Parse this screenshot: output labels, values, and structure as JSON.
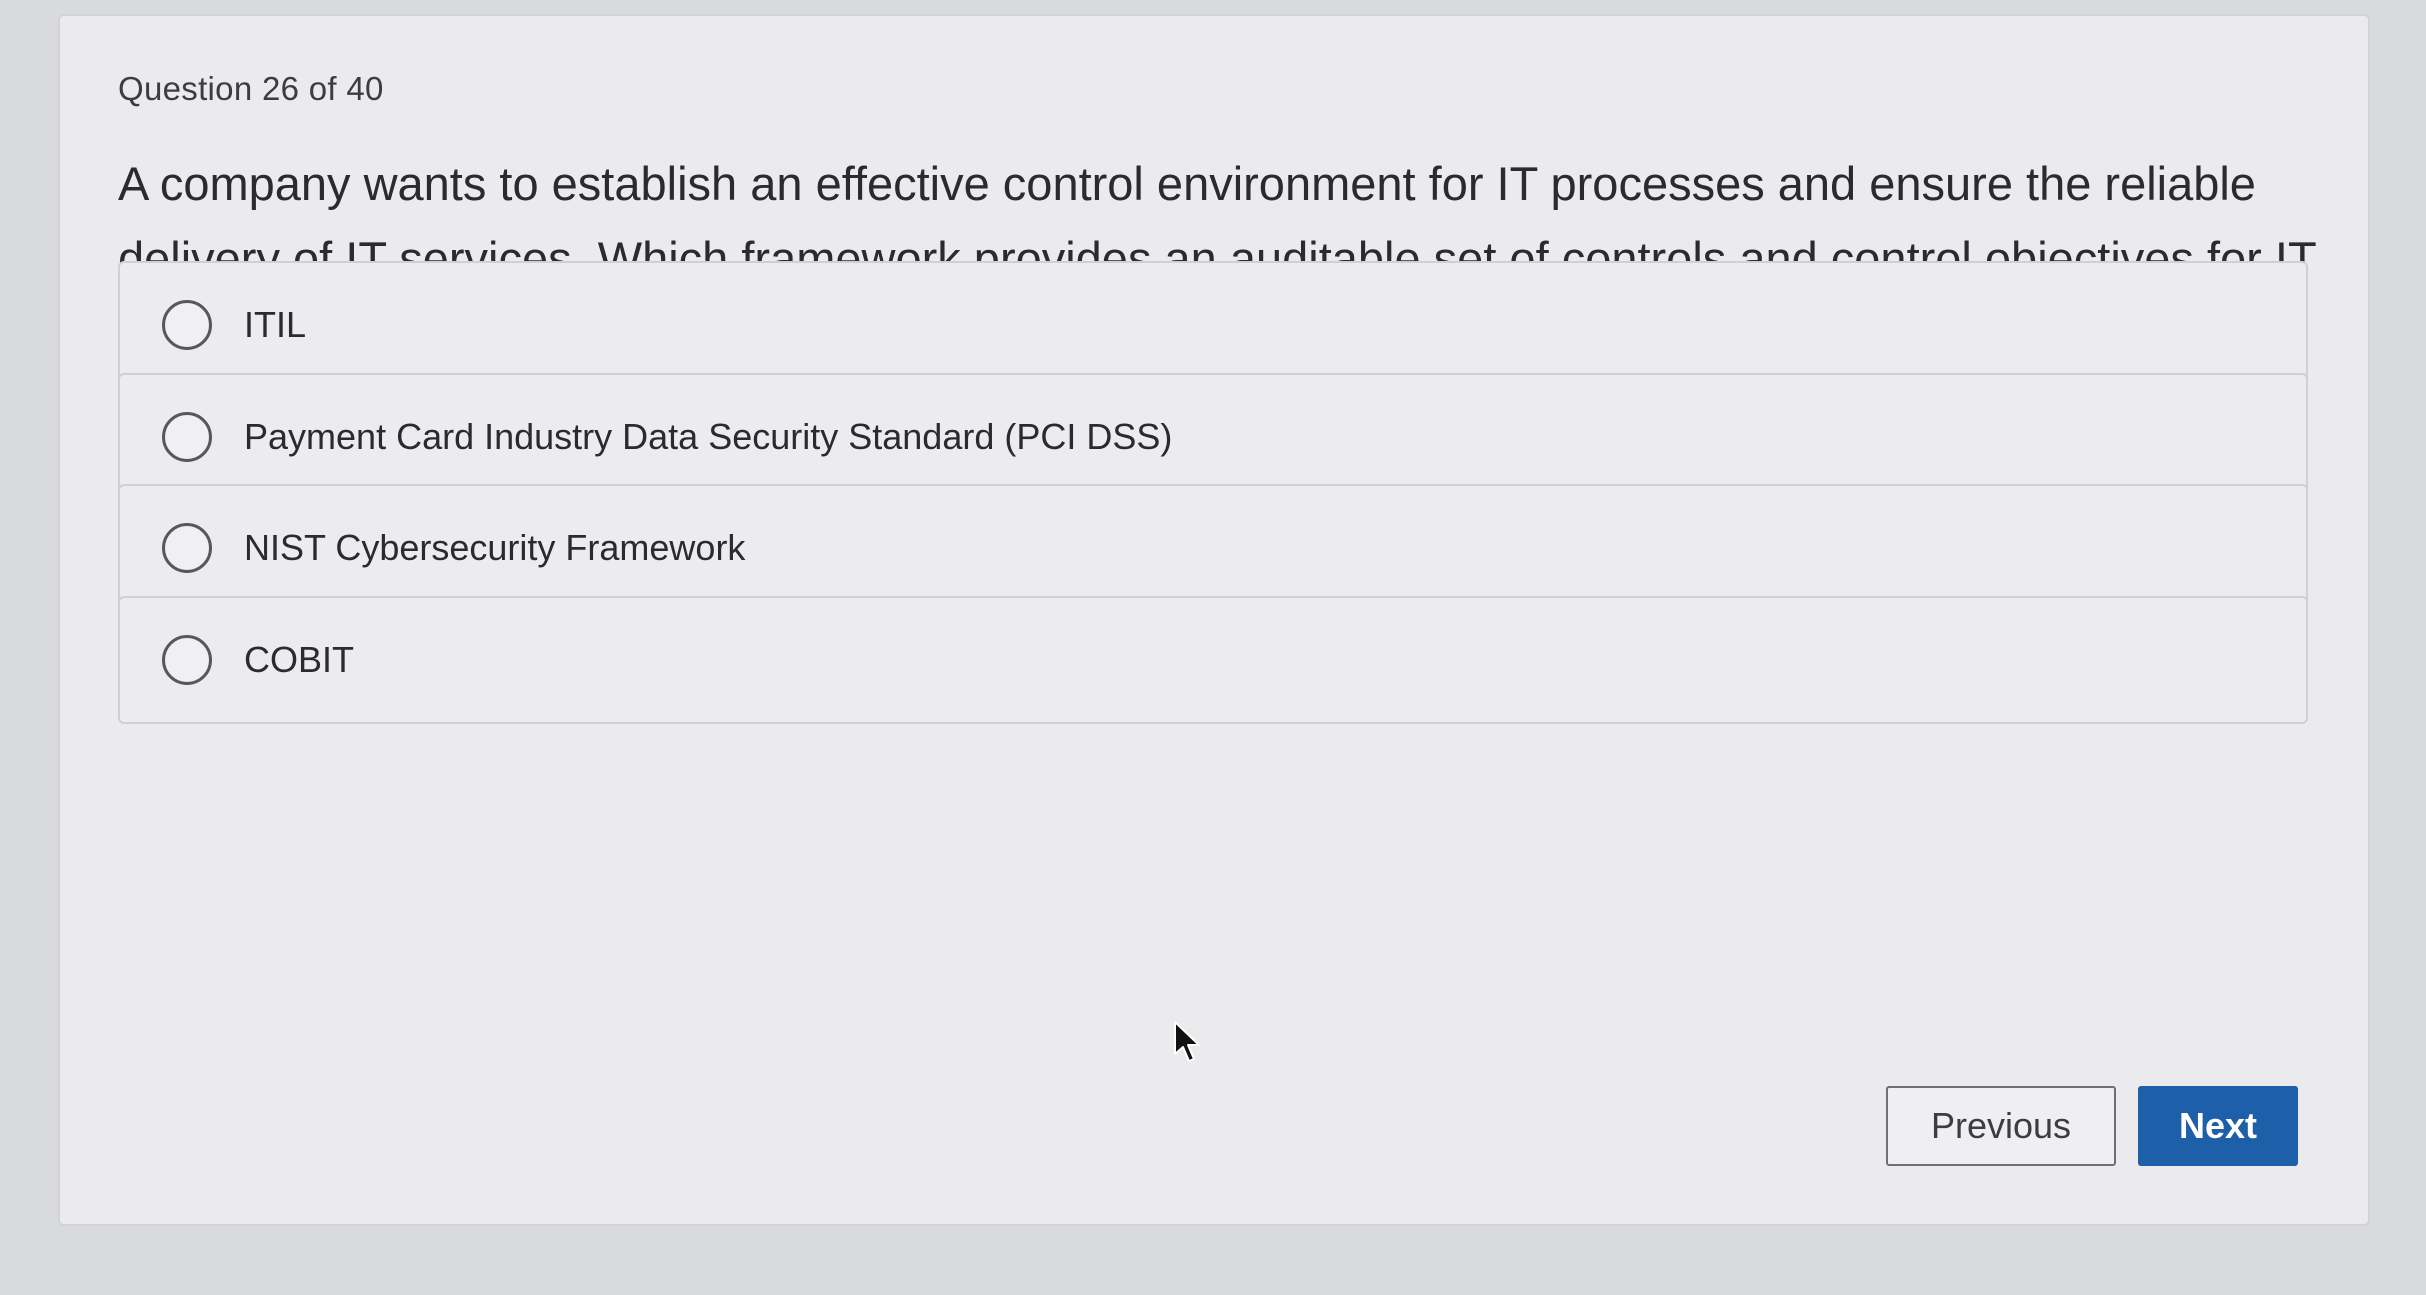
{
  "quiz": {
    "counter": "Question 26 of 40",
    "question": "A company wants to establish an effective control environment for IT processes and ensure the reliable delivery of IT services. Which framework provides an auditable set of controls and control objectives for IT governance and management?",
    "options": [
      {
        "label": "ITIL",
        "selected": false
      },
      {
        "label": "Payment Card Industry Data Security Standard (PCI DSS)",
        "selected": false
      },
      {
        "label": "NIST Cybersecurity Framework",
        "selected": false
      },
      {
        "label": "COBIT",
        "selected": false
      }
    ]
  },
  "navigation": {
    "previous_label": "Previous",
    "next_label": "Next"
  },
  "icons": {
    "radio": "radio-unselected-icon",
    "cursor": "mouse-pointer-icon"
  },
  "colors": {
    "accent": "#1d5fa8",
    "background": "#ebebed"
  }
}
